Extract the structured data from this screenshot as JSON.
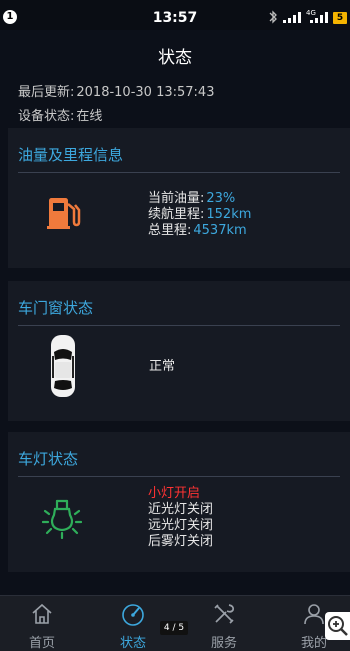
{
  "statusbar": {
    "notification_count": "1",
    "time": "13:57",
    "network_label": "4G",
    "battery": "5"
  },
  "header": {
    "title": "状态"
  },
  "meta": {
    "last_update_label": "最后更新:",
    "last_update_value": "2018-10-30 13:57:43",
    "device_status_label": "设备状态:",
    "device_status_value": "在线"
  },
  "fuel_card": {
    "title": "油量及里程信息",
    "icon": "fuel-pump-icon",
    "rows": [
      {
        "label": "当前油量:",
        "value": "23%"
      },
      {
        "label": "续航里程:",
        "value": "152km"
      },
      {
        "label": "总里程:",
        "value": "4537km"
      }
    ]
  },
  "door_card": {
    "title": "车门窗状态",
    "icon": "car-top-view-icon",
    "status": "正常"
  },
  "light_card": {
    "title": "车灯状态",
    "icon": "light-bulb-icon",
    "lights": [
      {
        "text": "小灯开启",
        "on": true
      },
      {
        "text": "近光灯关闭",
        "on": false
      },
      {
        "text": "远光灯关闭",
        "on": false
      },
      {
        "text": "后雾灯关闭",
        "on": false
      }
    ]
  },
  "nav": {
    "items": [
      {
        "label": "首页",
        "icon": "home-icon"
      },
      {
        "label": "状态",
        "icon": "speedometer-icon",
        "active": true
      },
      {
        "label": "服务",
        "icon": "tools-icon"
      },
      {
        "label": "我的",
        "icon": "user-icon"
      }
    ]
  },
  "pager": {
    "text": "4 / 5"
  },
  "colors": {
    "accent": "#3da8de",
    "fuel_icon": "#f07a3c",
    "light_icon": "#2fae5a",
    "light_on_text": "#ff3333",
    "background": "#0c1019",
    "card": "#161a23"
  }
}
